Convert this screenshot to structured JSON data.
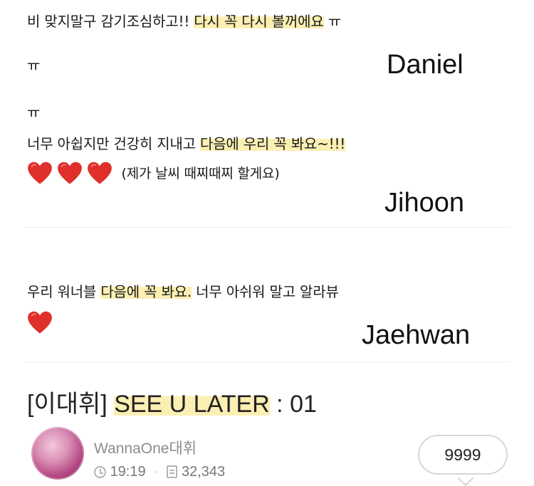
{
  "comments": [
    {
      "line1_plain": "비 맞지말구 감기조심하고!! ",
      "line1_highlight": "다시 꼭 다시 볼꺼에요",
      "line1_tail": " ㅠ",
      "line2": "ㅠ",
      "signature": "Daniel"
    },
    {
      "line0": "ㅠ",
      "line1_plain": "너무 아쉽지만 건강히 지내고 ",
      "line1_highlight": "다음에 우리 꼭 봐요~!!!",
      "line2_text": "(제가 날씨 때찌때찌 할게요)",
      "signature": "Jihoon"
    },
    {
      "line1_plain": "우리 워너블 ",
      "line1_highlight": "다음에 꼭 봐요.",
      "line1_tail": " 너무 아쉬워 말고 알라뷰",
      "signature": "Jaehwan"
    }
  ],
  "post": {
    "title_prefix": "[이대휘] ",
    "title_highlight": "SEE U LATER",
    "title_suffix": " : 01",
    "author": "WannaOne대휘",
    "time": "19:19",
    "views": "32,343",
    "comment_count": "9999"
  },
  "icons": {
    "heart": "heart-icon",
    "clock": "clock-icon",
    "views": "document-icon",
    "comment": "speech-bubble-icon"
  },
  "colors": {
    "highlight": "#fbefb3",
    "heart": "#e0302b",
    "meta_text": "#9a9a9a"
  }
}
